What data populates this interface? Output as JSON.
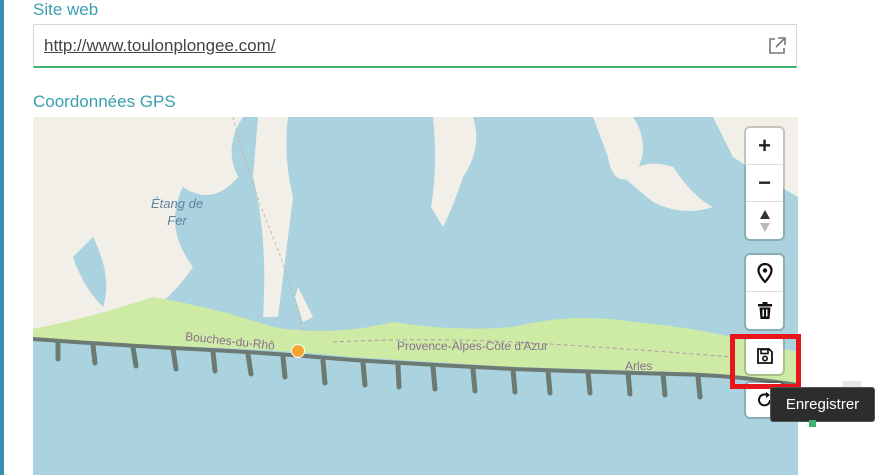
{
  "form": {
    "website_label": "Site web",
    "website_value": "http://www.toulonplongee.com/",
    "gps_label": "Coordonnées GPS"
  },
  "map": {
    "place_labels": {
      "etang_line1": "Étang de",
      "etang_line2": "Fer",
      "department": "Bouches-du-Rhô",
      "region": "Provence-Alpes-Côte d'Azur",
      "city": "Arles"
    },
    "controls": {
      "zoom_in": "+",
      "zoom_out": "−",
      "reset_north": "▲▼",
      "save_tooltip": "Enregistrer"
    },
    "marker_color": "#f4a430",
    "water_color": "#aad3df",
    "land_color": "#f2efe9",
    "vegetation_color": "#cdeba5"
  },
  "icons": [
    "external-link-icon",
    "zoom-in-icon",
    "zoom-out-icon",
    "compass-icon",
    "marker-icon",
    "trash-icon",
    "floppy-disk-icon",
    "reset-icon"
  ],
  "colors": {
    "label": "#3aa0b0",
    "input_focus_border": "#3cb371",
    "highlight": "#e8151b",
    "tooltip_bg": "#2d2d2d"
  }
}
